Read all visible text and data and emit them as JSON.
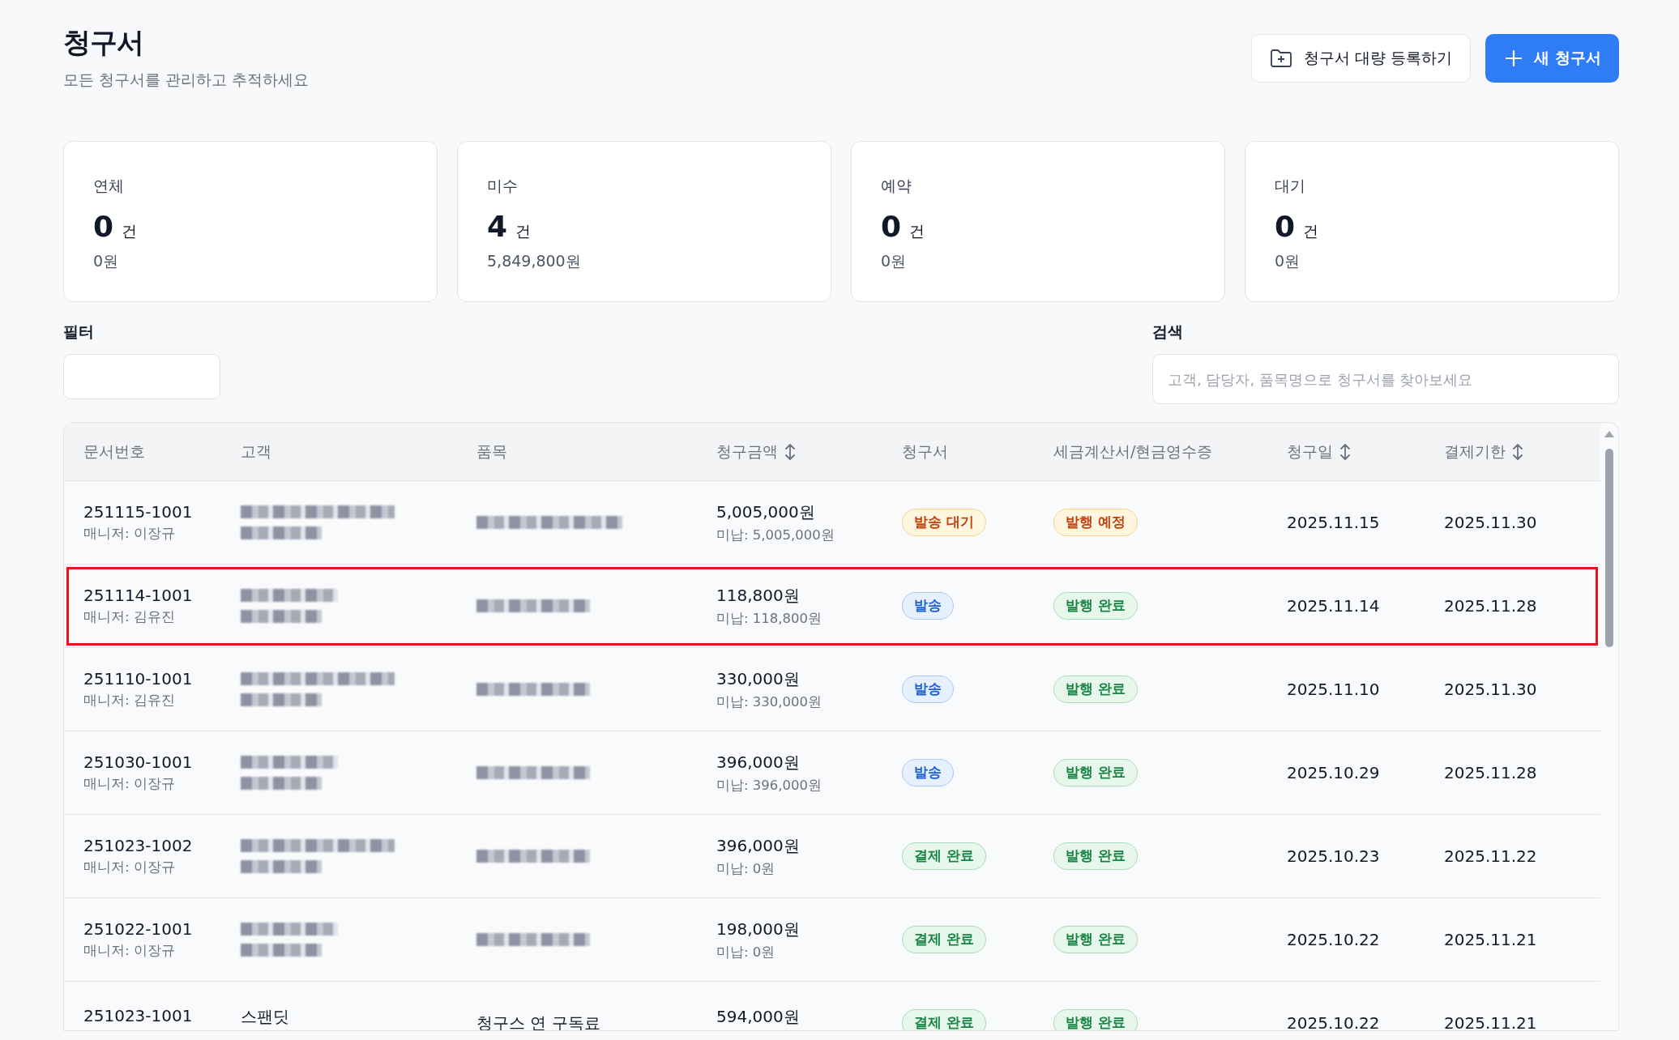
{
  "header": {
    "title": "청구서",
    "subtitle": "모든 청구서를 관리하고 추적하세요",
    "buttons": [
      {
        "kind": "bulk",
        "label": "청구서 대량 등록하기"
      },
      {
        "kind": "new",
        "label": "새 청구서"
      }
    ]
  },
  "stats": [
    {
      "label": "연체",
      "count": "0",
      "unit": "건",
      "amount": "0원"
    },
    {
      "label": "미수",
      "count": "4",
      "unit": "건",
      "amount": "5,849,800원"
    },
    {
      "label": "예약",
      "count": "0",
      "unit": "건",
      "amount": "0원"
    },
    {
      "label": "대기",
      "count": "0",
      "unit": "건",
      "amount": "0원"
    }
  ],
  "filter": {
    "label": "필터"
  },
  "search": {
    "label": "검색",
    "placeholder": "고객, 담당자, 품목명으로 청구서를 찾아보세요"
  },
  "table": {
    "columns": [
      {
        "label": "문서번호",
        "sortable": false
      },
      {
        "label": "고객",
        "sortable": false
      },
      {
        "label": "품목",
        "sortable": false
      },
      {
        "label": "청구금액",
        "sortable": true
      },
      {
        "label": "청구서",
        "sortable": false
      },
      {
        "label": "세금계산서/현금영수증",
        "sortable": false
      },
      {
        "label": "청구일",
        "sortable": true
      },
      {
        "label": "결제기한",
        "sortable": true
      }
    ],
    "rows": [
      {
        "number": "251115-1001",
        "manager": "매니저: 이장규",
        "customer": {
          "redacted": true
        },
        "item": {
          "redacted": true
        },
        "amount": "5,005,000원",
        "unpaid": "미납: 5,005,000원",
        "invoice": {
          "label": "발송 대기",
          "kind": "waiting"
        },
        "tax": {
          "label": "발행 예정",
          "kind": "waiting"
        },
        "billed": "2025.11.15",
        "due": "2025.11.30",
        "highlighted": false
      },
      {
        "number": "251114-1001",
        "manager": "매니저: 김유진",
        "customer": {
          "redacted": true
        },
        "item": {
          "redacted": true
        },
        "amount": "118,800원",
        "unpaid": "미납: 118,800원",
        "invoice": {
          "label": "발송",
          "kind": "sent"
        },
        "tax": {
          "label": "발행 완료",
          "kind": "done"
        },
        "billed": "2025.11.14",
        "due": "2025.11.28",
        "highlighted": true
      },
      {
        "number": "251110-1001",
        "manager": "매니저: 김유진",
        "customer": {
          "redacted": true
        },
        "item": {
          "redacted": true
        },
        "amount": "330,000원",
        "unpaid": "미납: 330,000원",
        "invoice": {
          "label": "발송",
          "kind": "sent"
        },
        "tax": {
          "label": "발행 완료",
          "kind": "done"
        },
        "billed": "2025.11.10",
        "due": "2025.11.30",
        "highlighted": false
      },
      {
        "number": "251030-1001",
        "manager": "매니저: 이장규",
        "customer": {
          "redacted": true
        },
        "item": {
          "redacted": true
        },
        "amount": "396,000원",
        "unpaid": "미납: 396,000원",
        "invoice": {
          "label": "발송",
          "kind": "sent"
        },
        "tax": {
          "label": "발행 완료",
          "kind": "done"
        },
        "billed": "2025.10.29",
        "due": "2025.11.28",
        "highlighted": false
      },
      {
        "number": "251023-1002",
        "manager": "매니저: 이장규",
        "customer": {
          "redacted": true
        },
        "item": {
          "redacted": true
        },
        "amount": "396,000원",
        "unpaid": "미납: 0원",
        "invoice": {
          "label": "결제 완료",
          "kind": "done"
        },
        "tax": {
          "label": "발행 완료",
          "kind": "done"
        },
        "billed": "2025.10.23",
        "due": "2025.11.22",
        "highlighted": false
      },
      {
        "number": "251022-1001",
        "manager": "매니저: 이장규",
        "customer": {
          "redacted": true
        },
        "item": {
          "redacted": true
        },
        "amount": "198,000원",
        "unpaid": "미납: 0원",
        "invoice": {
          "label": "결제 완료",
          "kind": "done"
        },
        "tax": {
          "label": "발행 완료",
          "kind": "done"
        },
        "billed": "2025.10.22",
        "due": "2025.11.21",
        "highlighted": false
      },
      {
        "number": "251023-1001",
        "customer": {
          "redacted": false,
          "name": "스팬딧"
        },
        "item": {
          "redacted": false,
          "text": "청구스 연 구독료"
        },
        "amount": "594,000원",
        "invoice": {
          "label": "결제 완료",
          "kind": "done"
        },
        "tax": {
          "label": "발행 완료",
          "kind": "done"
        },
        "billed": "2025.10.22",
        "due": "2025.11.21",
        "highlighted": false
      }
    ]
  }
}
